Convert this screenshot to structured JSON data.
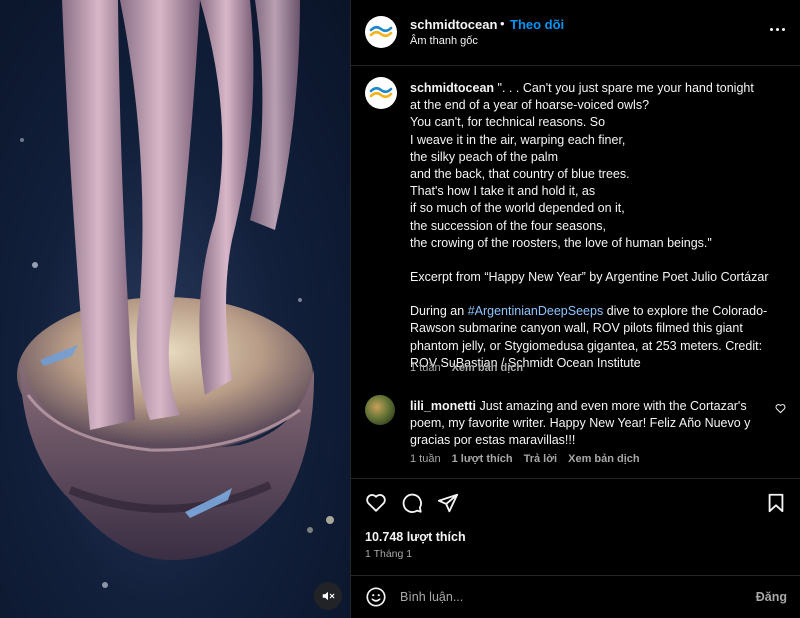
{
  "post": {
    "username": "schmidtocean",
    "separator": "•",
    "follow_label": "Theo dõi",
    "audio_label": "Âm thanh gốc",
    "more_icon": "more-options-icon"
  },
  "caption": {
    "username": "schmidtocean",
    "lines": [
      "\". . . Can't you just spare me your hand tonight",
      "at the end of a year of hoarse-voiced owls?",
      "You can't, for technical reasons. So",
      "I weave it in the air, warping each finer,",
      "the silky peach of the palm",
      "and the back, that country of blue trees.",
      "That's how I take it and hold it, as",
      "if so much of the world depended on it,",
      "the succession of the four seasons,",
      "the crowing of the roosters, the love of human beings.\""
    ],
    "excerpt": "Excerpt from “Happy New Year” by Argentine Poet Julio Cortázar",
    "desc_before": "During an ",
    "hashtag": "#ArgentinianDeepSeeps",
    "desc_after": " dive to explore the Colorado-Rawson submarine canyon wall, ROV pilots filmed this giant phantom jelly, or Stygiomedusa gigantea, at 253 meters. Credit: ROV SuBastian / Schmidt Ocean Institute",
    "time": "1 tuần",
    "see_translation": "Xem bản dịch"
  },
  "comment": {
    "username": "lili_monetti",
    "text": "Just amazing and even more with the Cortazar's poem, my favorite writer. Happy New Year! Feliz Año Nuevo y gracias por estas maravillas!!!",
    "time": "1 tuần",
    "likes": "1 lượt thích",
    "reply": "Trả lời",
    "see_translation": "Xem bản dịch"
  },
  "stats": {
    "likes": "10.748 lượt thích",
    "date": "1 Tháng 1"
  },
  "composer": {
    "placeholder": "Bình luận...",
    "post_label": "Đăng"
  },
  "colors": {
    "link": "#0095f6",
    "secondary_text": "#a8a8a8",
    "background": "#000000"
  }
}
